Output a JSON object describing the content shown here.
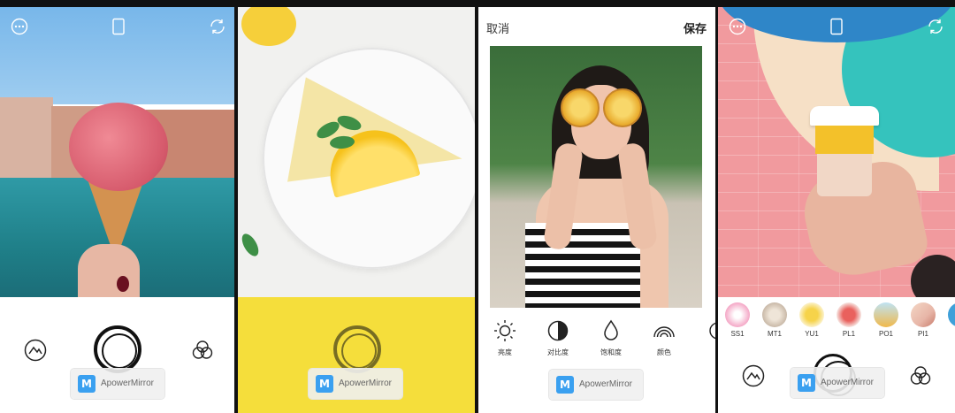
{
  "panels": {
    "camera_venice": {
      "watermark": "ApowerMirror"
    },
    "camera_lemon": {
      "watermark": "ApowerMirror"
    },
    "editor": {
      "cancel_label": "取消",
      "save_label": "保存",
      "tools": [
        {
          "label": "亮度",
          "icon": "sun-icon"
        },
        {
          "label": "对比度",
          "icon": "contrast-icon"
        },
        {
          "label": "饱和度",
          "icon": "drop-icon"
        },
        {
          "label": "颜色",
          "icon": "rainbow-icon"
        }
      ],
      "watermark": "ApowerMirror"
    },
    "camera_filters": {
      "filters": [
        {
          "label": "SS1",
          "color": "#f4a7c6"
        },
        {
          "label": "MT1",
          "color": "#c9b9a8"
        },
        {
          "label": "YU1",
          "color": "#f6d34a"
        },
        {
          "label": "PL1",
          "color": "#e9615d"
        },
        {
          "label": "PO1",
          "color": "#f0b94b"
        },
        {
          "label": "PI1",
          "color": "#e7b5a7"
        }
      ],
      "watermark": "ApowerMirror"
    }
  },
  "icons": {
    "more": "ellipsis-circle-icon",
    "frame": "phone-frame-icon",
    "switch": "camera-switch-icon",
    "mountain": "mountain-circle-icon",
    "filters": "three-circles-icon"
  },
  "colors": {
    "watermark_logo": "#3aa0f0",
    "lemon_band": "#f5de3b"
  }
}
